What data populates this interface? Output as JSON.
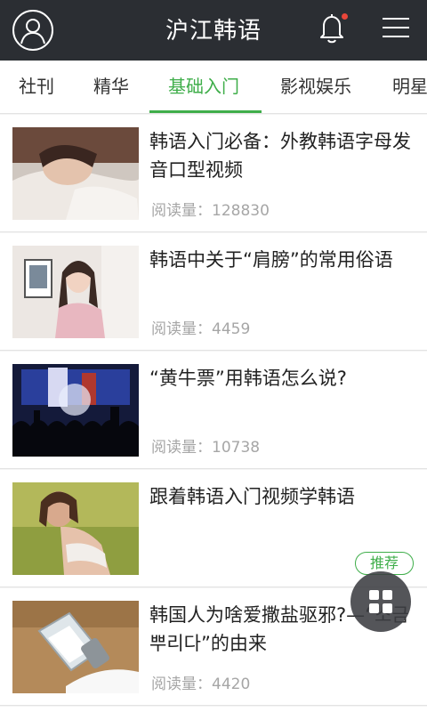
{
  "app": {
    "title": "沪江韩语",
    "notification_unread": true
  },
  "tabs": [
    {
      "label": "社刊",
      "active": false
    },
    {
      "label": "精华",
      "active": false
    },
    {
      "label": "基础入门",
      "active": true
    },
    {
      "label": "影视娱乐",
      "active": false
    },
    {
      "label": "明星",
      "active": false
    }
  ],
  "meta_label": "阅读量：",
  "articles": [
    {
      "title": "韩语入门必备：外教韩语字母发音口型视频",
      "meta": "阅读量：128830",
      "thumb": "sleeping-girl-photo"
    },
    {
      "title": "韩语中关于“肩膀”的常用俗语",
      "meta": "阅读量：4459",
      "thumb": "woman-holding-photo"
    },
    {
      "title": "“黄牛票”用韩语怎么说?",
      "meta": "阅读量：10738",
      "thumb": "concert-crowd-photo"
    },
    {
      "title": "跟着韩语入门视频学韩语",
      "meta": "",
      "badge": "推荐",
      "thumb": "woman-on-grass-photo"
    },
    {
      "title": "韩国人为啥爱撒盐驱邪?—“소금 뿌리다”的由来",
      "meta": "阅读量：4420",
      "thumb": "salt-shaker-photo"
    }
  ],
  "colors": {
    "header_bg": "#2b2e33",
    "accent": "#3fae4a",
    "notification_dot": "#e8463a",
    "meta_text": "#a6a6a6"
  },
  "icons": {
    "avatar": "user-avatar-icon",
    "bell": "bell-icon",
    "menu": "hamburger-menu-icon",
    "fab": "grid-icon"
  }
}
